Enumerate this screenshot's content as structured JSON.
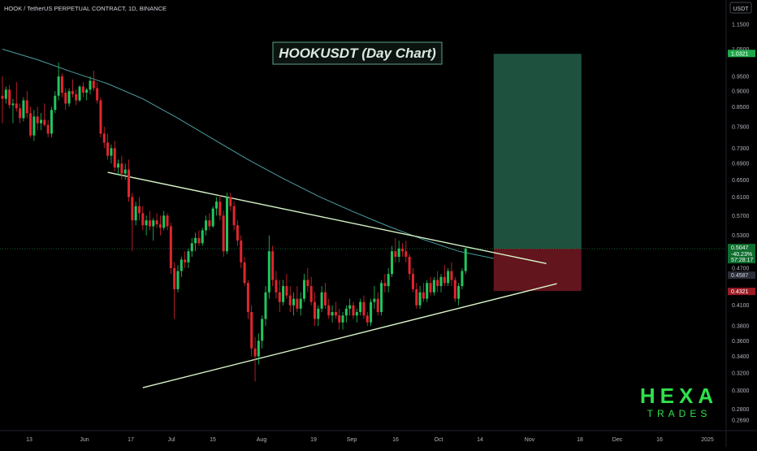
{
  "header": {
    "title": "HOOK / TetherUS PERPETUAL CONTRACT, 1D, BINANCE"
  },
  "currency_badge": "USDT",
  "chart_title": "HOOKUSDT (Day Chart)",
  "watermark": {
    "line1": "HEXA",
    "line2": "TRADES"
  },
  "colors": {
    "background": "#000000",
    "up": "#22c55e",
    "down": "#e0262e",
    "ma": "#4c9fa0",
    "trendline": "#d8f5c8",
    "profit_zone": "#23604a",
    "loss_zone": "#6d1720",
    "title_box": "#5aa383",
    "watermark": "#2fe04a",
    "price_axis_text": "#b2b5be"
  },
  "price_axis": {
    "ticks": [
      "1.1500",
      "1.0500",
      "0.9500",
      "0.9000",
      "0.8500",
      "0.7900",
      "0.7300",
      "0.6900",
      "0.6500",
      "0.6100",
      "0.5700",
      "0.5300",
      "0.4700",
      "0.4100",
      "0.3800",
      "0.3600",
      "0.3400",
      "0.3200",
      "0.3000",
      "0.2800",
      "0.2690"
    ],
    "labels": [
      {
        "text": "1.0321",
        "style": "green"
      },
      {
        "text": "0.5047",
        "style": "green"
      },
      {
        "text": "-40.23%",
        "style": "green"
      },
      {
        "text": "57:28:17",
        "style": "green"
      },
      {
        "text": "0.4587",
        "style": "gray"
      },
      {
        "text": "0.4321",
        "style": "red"
      }
    ]
  },
  "time_axis": {
    "labels": [
      "13",
      "Jun",
      "17",
      "Jul",
      "15",
      "Aug",
      "19",
      "Sep",
      "16",
      "Oct",
      "14",
      "Nov",
      "18",
      "Dec",
      "16",
      "2025"
    ]
  },
  "chart_data": {
    "type": "candlestick",
    "scale": "log",
    "title": "HOOKUSDT (Day Chart)",
    "ylim": [
      0.265,
      1.2
    ],
    "current_price": 0.5047,
    "candles": [
      {
        "o": 0.885,
        "h": 0.95,
        "l": 0.8,
        "c": 0.875
      },
      {
        "o": 0.875,
        "h": 0.915,
        "l": 0.86,
        "c": 0.905
      },
      {
        "o": 0.905,
        "h": 0.92,
        "l": 0.845,
        "c": 0.855
      },
      {
        "o": 0.855,
        "h": 0.875,
        "l": 0.8,
        "c": 0.86
      },
      {
        "o": 0.86,
        "h": 0.93,
        "l": 0.835,
        "c": 0.845
      },
      {
        "o": 0.845,
        "h": 0.86,
        "l": 0.8,
        "c": 0.815
      },
      {
        "o": 0.815,
        "h": 0.88,
        "l": 0.805,
        "c": 0.87
      },
      {
        "o": 0.87,
        "h": 0.9,
        "l": 0.815,
        "c": 0.83
      },
      {
        "o": 0.83,
        "h": 0.85,
        "l": 0.76,
        "c": 0.765
      },
      {
        "o": 0.765,
        "h": 0.84,
        "l": 0.75,
        "c": 0.82
      },
      {
        "o": 0.82,
        "h": 0.85,
        "l": 0.78,
        "c": 0.8
      },
      {
        "o": 0.8,
        "h": 0.83,
        "l": 0.78,
        "c": 0.81
      },
      {
        "o": 0.81,
        "h": 0.86,
        "l": 0.79,
        "c": 0.795
      },
      {
        "o": 0.795,
        "h": 0.81,
        "l": 0.76,
        "c": 0.77
      },
      {
        "o": 0.77,
        "h": 0.85,
        "l": 0.76,
        "c": 0.84
      },
      {
        "o": 0.84,
        "h": 0.9,
        "l": 0.83,
        "c": 0.885
      },
      {
        "o": 0.885,
        "h": 1.0,
        "l": 0.87,
        "c": 0.95
      },
      {
        "o": 0.95,
        "h": 0.96,
        "l": 0.88,
        "c": 0.895
      },
      {
        "o": 0.895,
        "h": 0.91,
        "l": 0.84,
        "c": 0.86
      },
      {
        "o": 0.86,
        "h": 0.91,
        "l": 0.85,
        "c": 0.9
      },
      {
        "o": 0.9,
        "h": 0.94,
        "l": 0.88,
        "c": 0.89
      },
      {
        "o": 0.89,
        "h": 0.905,
        "l": 0.855,
        "c": 0.87
      },
      {
        "o": 0.87,
        "h": 0.92,
        "l": 0.865,
        "c": 0.915
      },
      {
        "o": 0.915,
        "h": 0.93,
        "l": 0.88,
        "c": 0.895
      },
      {
        "o": 0.895,
        "h": 0.91,
        "l": 0.87,
        "c": 0.905
      },
      {
        "o": 0.905,
        "h": 0.95,
        "l": 0.89,
        "c": 0.935
      },
      {
        "o": 0.935,
        "h": 0.97,
        "l": 0.9,
        "c": 0.91
      },
      {
        "o": 0.91,
        "h": 0.93,
        "l": 0.86,
        "c": 0.87
      },
      {
        "o": 0.87,
        "h": 0.88,
        "l": 0.76,
        "c": 0.77
      },
      {
        "o": 0.77,
        "h": 0.79,
        "l": 0.73,
        "c": 0.745
      },
      {
        "o": 0.745,
        "h": 0.77,
        "l": 0.7,
        "c": 0.71
      },
      {
        "o": 0.71,
        "h": 0.74,
        "l": 0.69,
        "c": 0.73
      },
      {
        "o": 0.73,
        "h": 0.75,
        "l": 0.67,
        "c": 0.68
      },
      {
        "o": 0.68,
        "h": 0.7,
        "l": 0.66,
        "c": 0.69
      },
      {
        "o": 0.69,
        "h": 0.71,
        "l": 0.65,
        "c": 0.665
      },
      {
        "o": 0.665,
        "h": 0.69,
        "l": 0.65,
        "c": 0.675
      },
      {
        "o": 0.675,
        "h": 0.7,
        "l": 0.6,
        "c": 0.61
      },
      {
        "o": 0.61,
        "h": 0.62,
        "l": 0.5,
        "c": 0.56
      },
      {
        "o": 0.56,
        "h": 0.6,
        "l": 0.55,
        "c": 0.59
      },
      {
        "o": 0.59,
        "h": 0.61,
        "l": 0.56,
        "c": 0.575
      },
      {
        "o": 0.575,
        "h": 0.59,
        "l": 0.54,
        "c": 0.55
      },
      {
        "o": 0.55,
        "h": 0.57,
        "l": 0.53,
        "c": 0.56
      },
      {
        "o": 0.56,
        "h": 0.58,
        "l": 0.54,
        "c": 0.548
      },
      {
        "o": 0.548,
        "h": 0.565,
        "l": 0.52,
        "c": 0.56
      },
      {
        "o": 0.56,
        "h": 0.575,
        "l": 0.545,
        "c": 0.552
      },
      {
        "o": 0.552,
        "h": 0.57,
        "l": 0.53,
        "c": 0.545
      },
      {
        "o": 0.545,
        "h": 0.58,
        "l": 0.54,
        "c": 0.57
      },
      {
        "o": 0.57,
        "h": 0.575,
        "l": 0.54,
        "c": 0.548
      },
      {
        "o": 0.548,
        "h": 0.555,
        "l": 0.46,
        "c": 0.47
      },
      {
        "o": 0.47,
        "h": 0.48,
        "l": 0.39,
        "c": 0.435
      },
      {
        "o": 0.435,
        "h": 0.475,
        "l": 0.43,
        "c": 0.465
      },
      {
        "o": 0.465,
        "h": 0.49,
        "l": 0.455,
        "c": 0.485
      },
      {
        "o": 0.485,
        "h": 0.5,
        "l": 0.47,
        "c": 0.48
      },
      {
        "o": 0.48,
        "h": 0.505,
        "l": 0.47,
        "c": 0.5
      },
      {
        "o": 0.5,
        "h": 0.525,
        "l": 0.49,
        "c": 0.515
      },
      {
        "o": 0.515,
        "h": 0.535,
        "l": 0.5,
        "c": 0.525
      },
      {
        "o": 0.525,
        "h": 0.54,
        "l": 0.51,
        "c": 0.515
      },
      {
        "o": 0.515,
        "h": 0.545,
        "l": 0.51,
        "c": 0.54
      },
      {
        "o": 0.54,
        "h": 0.57,
        "l": 0.53,
        "c": 0.56
      },
      {
        "o": 0.56,
        "h": 0.575,
        "l": 0.54,
        "c": 0.548
      },
      {
        "o": 0.548,
        "h": 0.59,
        "l": 0.545,
        "c": 0.585
      },
      {
        "o": 0.585,
        "h": 0.61,
        "l": 0.57,
        "c": 0.6
      },
      {
        "o": 0.6,
        "h": 0.615,
        "l": 0.56,
        "c": 0.57
      },
      {
        "o": 0.57,
        "h": 0.58,
        "l": 0.49,
        "c": 0.5
      },
      {
        "o": 0.5,
        "h": 0.62,
        "l": 0.495,
        "c": 0.61
      },
      {
        "o": 0.61,
        "h": 0.62,
        "l": 0.58,
        "c": 0.59
      },
      {
        "o": 0.59,
        "h": 0.6,
        "l": 0.54,
        "c": 0.55
      },
      {
        "o": 0.55,
        "h": 0.56,
        "l": 0.51,
        "c": 0.52
      },
      {
        "o": 0.52,
        "h": 0.53,
        "l": 0.47,
        "c": 0.48
      },
      {
        "o": 0.48,
        "h": 0.49,
        "l": 0.44,
        "c": 0.445
      },
      {
        "o": 0.445,
        "h": 0.45,
        "l": 0.39,
        "c": 0.4
      },
      {
        "o": 0.4,
        "h": 0.41,
        "l": 0.34,
        "c": 0.35
      },
      {
        "o": 0.35,
        "h": 0.365,
        "l": 0.31,
        "c": 0.34
      },
      {
        "o": 0.34,
        "h": 0.37,
        "l": 0.33,
        "c": 0.36
      },
      {
        "o": 0.36,
        "h": 0.395,
        "l": 0.35,
        "c": 0.39
      },
      {
        "o": 0.39,
        "h": 0.44,
        "l": 0.38,
        "c": 0.43
      },
      {
        "o": 0.43,
        "h": 0.53,
        "l": 0.42,
        "c": 0.5
      },
      {
        "o": 0.5,
        "h": 0.51,
        "l": 0.44,
        "c": 0.45
      },
      {
        "o": 0.45,
        "h": 0.465,
        "l": 0.42,
        "c": 0.43
      },
      {
        "o": 0.43,
        "h": 0.45,
        "l": 0.4,
        "c": 0.415
      },
      {
        "o": 0.415,
        "h": 0.45,
        "l": 0.41,
        "c": 0.44
      },
      {
        "o": 0.44,
        "h": 0.46,
        "l": 0.42,
        "c": 0.425
      },
      {
        "o": 0.425,
        "h": 0.44,
        "l": 0.4,
        "c": 0.41
      },
      {
        "o": 0.41,
        "h": 0.43,
        "l": 0.395,
        "c": 0.42
      },
      {
        "o": 0.42,
        "h": 0.44,
        "l": 0.4,
        "c": 0.405
      },
      {
        "o": 0.405,
        "h": 0.43,
        "l": 0.395,
        "c": 0.42
      },
      {
        "o": 0.42,
        "h": 0.46,
        "l": 0.415,
        "c": 0.45
      },
      {
        "o": 0.45,
        "h": 0.47,
        "l": 0.43,
        "c": 0.44
      },
      {
        "o": 0.44,
        "h": 0.455,
        "l": 0.41,
        "c": 0.415
      },
      {
        "o": 0.415,
        "h": 0.43,
        "l": 0.38,
        "c": 0.39
      },
      {
        "o": 0.39,
        "h": 0.41,
        "l": 0.38,
        "c": 0.405
      },
      {
        "o": 0.405,
        "h": 0.44,
        "l": 0.4,
        "c": 0.43
      },
      {
        "o": 0.43,
        "h": 0.445,
        "l": 0.405,
        "c": 0.41
      },
      {
        "o": 0.41,
        "h": 0.42,
        "l": 0.39,
        "c": 0.395
      },
      {
        "o": 0.395,
        "h": 0.41,
        "l": 0.385,
        "c": 0.4
      },
      {
        "o": 0.4,
        "h": 0.415,
        "l": 0.39,
        "c": 0.395
      },
      {
        "o": 0.395,
        "h": 0.405,
        "l": 0.375,
        "c": 0.385
      },
      {
        "o": 0.385,
        "h": 0.4,
        "l": 0.375,
        "c": 0.395
      },
      {
        "o": 0.395,
        "h": 0.41,
        "l": 0.385,
        "c": 0.405
      },
      {
        "o": 0.405,
        "h": 0.42,
        "l": 0.395,
        "c": 0.41
      },
      {
        "o": 0.41,
        "h": 0.415,
        "l": 0.39,
        "c": 0.395
      },
      {
        "o": 0.395,
        "h": 0.405,
        "l": 0.385,
        "c": 0.4
      },
      {
        "o": 0.4,
        "h": 0.42,
        "l": 0.395,
        "c": 0.415
      },
      {
        "o": 0.415,
        "h": 0.425,
        "l": 0.39,
        "c": 0.395
      },
      {
        "o": 0.395,
        "h": 0.4,
        "l": 0.38,
        "c": 0.385
      },
      {
        "o": 0.385,
        "h": 0.42,
        "l": 0.38,
        "c": 0.415
      },
      {
        "o": 0.415,
        "h": 0.44,
        "l": 0.405,
        "c": 0.42
      },
      {
        "o": 0.42,
        "h": 0.43,
        "l": 0.395,
        "c": 0.4
      },
      {
        "o": 0.4,
        "h": 0.45,
        "l": 0.395,
        "c": 0.445
      },
      {
        "o": 0.445,
        "h": 0.46,
        "l": 0.43,
        "c": 0.44
      },
      {
        "o": 0.44,
        "h": 0.47,
        "l": 0.43,
        "c": 0.46
      },
      {
        "o": 0.46,
        "h": 0.51,
        "l": 0.455,
        "c": 0.5
      },
      {
        "o": 0.5,
        "h": 0.525,
        "l": 0.48,
        "c": 0.49
      },
      {
        "o": 0.49,
        "h": 0.52,
        "l": 0.48,
        "c": 0.505
      },
      {
        "o": 0.505,
        "h": 0.515,
        "l": 0.49,
        "c": 0.5
      },
      {
        "o": 0.5,
        "h": 0.52,
        "l": 0.48,
        "c": 0.49
      },
      {
        "o": 0.49,
        "h": 0.495,
        "l": 0.45,
        "c": 0.46
      },
      {
        "o": 0.46,
        "h": 0.47,
        "l": 0.43,
        "c": 0.435
      },
      {
        "o": 0.435,
        "h": 0.445,
        "l": 0.405,
        "c": 0.41
      },
      {
        "o": 0.41,
        "h": 0.44,
        "l": 0.405,
        "c": 0.43
      },
      {
        "o": 0.43,
        "h": 0.445,
        "l": 0.415,
        "c": 0.42
      },
      {
        "o": 0.42,
        "h": 0.45,
        "l": 0.415,
        "c": 0.445
      },
      {
        "o": 0.445,
        "h": 0.455,
        "l": 0.425,
        "c": 0.43
      },
      {
        "o": 0.43,
        "h": 0.455,
        "l": 0.425,
        "c": 0.45
      },
      {
        "o": 0.45,
        "h": 0.465,
        "l": 0.43,
        "c": 0.44
      },
      {
        "o": 0.44,
        "h": 0.46,
        "l": 0.43,
        "c": 0.455
      },
      {
        "o": 0.455,
        "h": 0.475,
        "l": 0.44,
        "c": 0.445
      },
      {
        "o": 0.445,
        "h": 0.47,
        "l": 0.44,
        "c": 0.465
      },
      {
        "o": 0.465,
        "h": 0.48,
        "l": 0.44,
        "c": 0.45
      },
      {
        "o": 0.45,
        "h": 0.455,
        "l": 0.415,
        "c": 0.42
      },
      {
        "o": 0.42,
        "h": 0.445,
        "l": 0.41,
        "c": 0.44
      },
      {
        "o": 0.44,
        "h": 0.47,
        "l": 0.435,
        "c": 0.465
      },
      {
        "o": 0.465,
        "h": 0.51,
        "l": 0.46,
        "c": 0.505
      }
    ],
    "moving_average": [
      {
        "i": 0,
        "v": 1.05
      },
      {
        "i": 10,
        "v": 1.01
      },
      {
        "i": 20,
        "v": 0.965
      },
      {
        "i": 30,
        "v": 0.925
      },
      {
        "i": 40,
        "v": 0.875
      },
      {
        "i": 50,
        "v": 0.815
      },
      {
        "i": 60,
        "v": 0.755
      },
      {
        "i": 70,
        "v": 0.7
      },
      {
        "i": 80,
        "v": 0.653
      },
      {
        "i": 90,
        "v": 0.612
      },
      {
        "i": 100,
        "v": 0.578
      },
      {
        "i": 110,
        "v": 0.548
      },
      {
        "i": 120,
        "v": 0.522
      },
      {
        "i": 130,
        "v": 0.5
      },
      {
        "i": 140,
        "v": 0.487
      }
    ],
    "trendlines": [
      {
        "name": "descending resistance",
        "from": {
          "i": 30,
          "v": 0.668
        },
        "to": {
          "i": 155,
          "v": 0.478
        }
      },
      {
        "name": "ascending support",
        "from": {
          "i": 40,
          "v": 0.303
        },
        "to": {
          "i": 158,
          "v": 0.444
        }
      }
    ],
    "position": {
      "entry": 0.5047,
      "target": 1.0321,
      "stop": 0.4321,
      "start_index": 140,
      "end_index": 165
    }
  }
}
